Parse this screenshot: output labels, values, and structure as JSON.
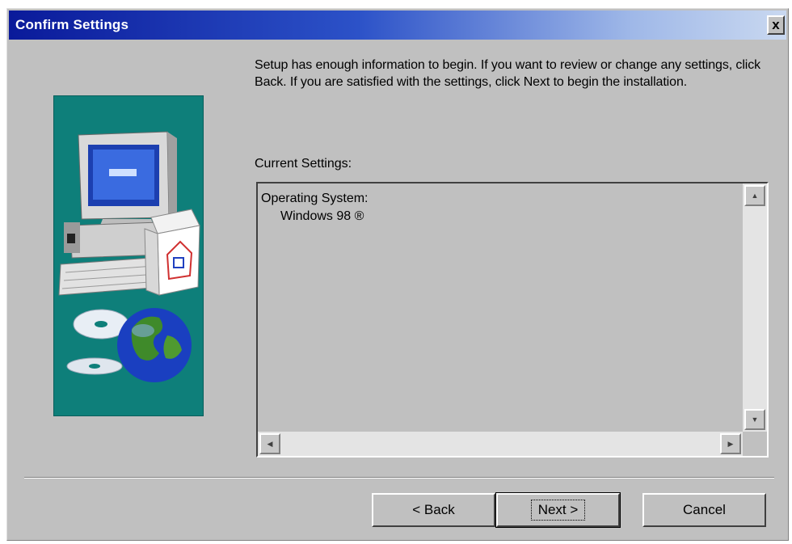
{
  "window": {
    "title": "Confirm Settings",
    "close_label": "x"
  },
  "content": {
    "description": "Setup has enough information to begin.  If you want to review or change any settings, click Back.  If you are satisfied with the settings, click Next to begin the installation.",
    "current_settings_label": "Current Settings:",
    "settings": {
      "heading": "Operating System:",
      "value": "Windows 98 ®"
    }
  },
  "buttons": {
    "back": "< Back",
    "next": "Next >",
    "cancel": "Cancel"
  },
  "colors": {
    "dialog_face": "#c0c0c0",
    "title_gradient_start": "#0a1a9a",
    "illustration_bg": "#0e7f7a"
  },
  "icons": [
    "close-icon",
    "computer-icon",
    "package-box-icon",
    "cd-disc-icon",
    "globe-icon",
    "scroll-up-icon",
    "scroll-down-icon",
    "scroll-left-icon",
    "scroll-right-icon"
  ]
}
